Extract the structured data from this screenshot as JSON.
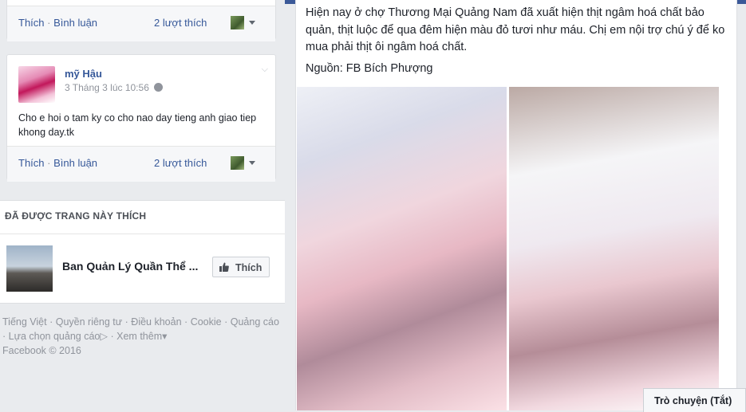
{
  "post_top": {
    "actions": {
      "like": "Thích",
      "comment": "Bình luận",
      "separator": "·"
    },
    "likes_count": "2 lượt thích"
  },
  "post2": {
    "author": "mỹ Hậu",
    "timestamp": "3 Tháng 3 lúc 10:56",
    "text": "Cho e hoi o tam ky co cho nao day tieng anh giao tiep khong day.tk",
    "actions": {
      "like": "Thích",
      "comment": "Bình luận",
      "separator": "·"
    },
    "likes_count": "2 lượt thích"
  },
  "liked_pages": {
    "heading": "ĐÃ ĐƯỢC TRANG NÀY THÍCH",
    "page_name": "Ban Quản Lý Quần Thể ...",
    "like_button": "Thích"
  },
  "footer": {
    "links": [
      "Tiếng Việt",
      "Quyền riêng tư",
      "Điều khoản",
      "Cookie",
      "Quảng cáo",
      "Lựa chọn quảng cáo",
      "Xem thêm"
    ],
    "separator": "·",
    "copyright": "Facebook © 2016"
  },
  "main_post": {
    "text": "Hiện nay ở chợ Thương Mại Quảng Nam đã xuất hiện thịt ngâm hoá chất bảo quản, thịt luộc để qua đêm hiện màu đỏ tươi như máu. Chị em nội trợ chú ý để ko mua phải thịt ôi ngâm hoá chất.",
    "source": "Nguồn: FB Bích Phượng"
  },
  "chat": {
    "label": "Trò chuyện (Tắt)"
  },
  "colors": {
    "brand": "#3b5998",
    "link": "#365899",
    "background": "#e9ebee"
  }
}
